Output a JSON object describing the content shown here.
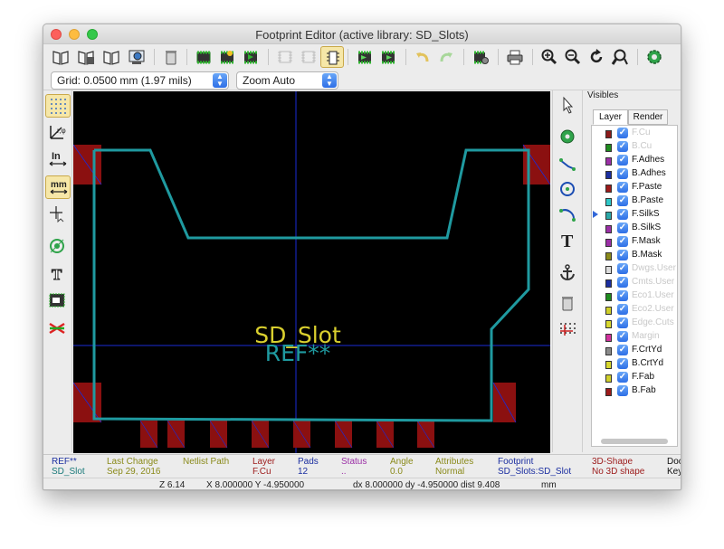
{
  "window": {
    "title": "Footprint Editor (active library: SD_Slots)"
  },
  "options": {
    "grid": "Grid: 0.0500 mm (1.97 mils)",
    "zoom": "Zoom Auto"
  },
  "canvas": {
    "value_text": "SD_Slot",
    "reference_text": "REF**"
  },
  "visibles": {
    "title": "Visibles",
    "tabs": [
      "Layer",
      "Render"
    ],
    "layers": [
      {
        "name": "F.Cu",
        "color": "#8b1a1a",
        "dim": true
      },
      {
        "name": "B.Cu",
        "color": "#1e8c1e",
        "dim": true
      },
      {
        "name": "F.Adhes",
        "color": "#9b2fa6",
        "dim": false
      },
      {
        "name": "B.Adhes",
        "color": "#1b2ea0",
        "dim": false
      },
      {
        "name": "F.Paste",
        "color": "#9c1a1a",
        "dim": false
      },
      {
        "name": "B.Paste",
        "color": "#2ec7c7",
        "dim": false
      },
      {
        "name": "F.SilkS",
        "color": "#2aa7a7",
        "dim": false
      },
      {
        "name": "B.SilkS",
        "color": "#9b2fa6",
        "dim": false
      },
      {
        "name": "F.Mask",
        "color": "#9b2fa6",
        "dim": false
      },
      {
        "name": "B.Mask",
        "color": "#8a8a1a",
        "dim": false
      },
      {
        "name": "Dwgs.User",
        "color": "#dcdcdc",
        "dim": true
      },
      {
        "name": "Cmts.User",
        "color": "#1b2ea0",
        "dim": true
      },
      {
        "name": "Eco1.User",
        "color": "#1e8c1e",
        "dim": true
      },
      {
        "name": "Eco2.User",
        "color": "#cfcf2a",
        "dim": true
      },
      {
        "name": "Edge.Cuts",
        "color": "#d8d82e",
        "dim": true
      },
      {
        "name": "Margin",
        "color": "#d1319e",
        "dim": true
      },
      {
        "name": "F.CrtYd",
        "color": "#8a8a8a",
        "dim": false
      },
      {
        "name": "B.CrtYd",
        "color": "#d8d82e",
        "dim": false
      },
      {
        "name": "F.Fab",
        "color": "#cfcf2a",
        "dim": false
      },
      {
        "name": "B.Fab",
        "color": "#9c1a1a",
        "dim": false
      }
    ]
  },
  "msgpanel": [
    {
      "label": "REF**",
      "value": "SD_Slot",
      "color": "#1b2ea0",
      "vcolor": "#1b7a7a"
    },
    {
      "label": "Last Change",
      "value": "Sep 29, 2016",
      "color": "#8a8a1a",
      "vcolor": "#8a8a1a"
    },
    {
      "label": "Netlist Path",
      "value": "",
      "color": "#8a8a1a",
      "vcolor": "#8a8a1a"
    },
    {
      "label": "Layer",
      "value": "F.Cu",
      "color": "#9c1a1a",
      "vcolor": "#9c1a1a"
    },
    {
      "label": "Pads",
      "value": "12",
      "color": "#1b2ea0",
      "vcolor": "#1b2ea0"
    },
    {
      "label": "Status",
      "value": "..",
      "color": "#9b2fa6",
      "vcolor": "#9b2fa6"
    },
    {
      "label": "Angle",
      "value": "0.0",
      "color": "#8a8a1a",
      "vcolor": "#8a8a1a"
    },
    {
      "label": "Attributes",
      "value": "Normal",
      "color": "#8a8a1a",
      "vcolor": "#8a8a1a"
    },
    {
      "label": "Footprint",
      "value": "SD_Slots:SD_Slot",
      "color": "#1b2ea0",
      "vcolor": "#1b2ea0"
    },
    {
      "label": "3D-Shape",
      "value": "No 3D shape",
      "color": "#9c1a1a",
      "vcolor": "#9c1a1a"
    },
    {
      "label": "Doc",
      "value": "Key",
      "color": "#111111",
      "vcolor": "#111111"
    }
  ],
  "status": {
    "zoom": "Z 6.14",
    "abs": "X 8.000000  Y -4.950000",
    "rel": "dx 8.000000  dy -4.950000  dist 9.408",
    "units": "mm"
  }
}
